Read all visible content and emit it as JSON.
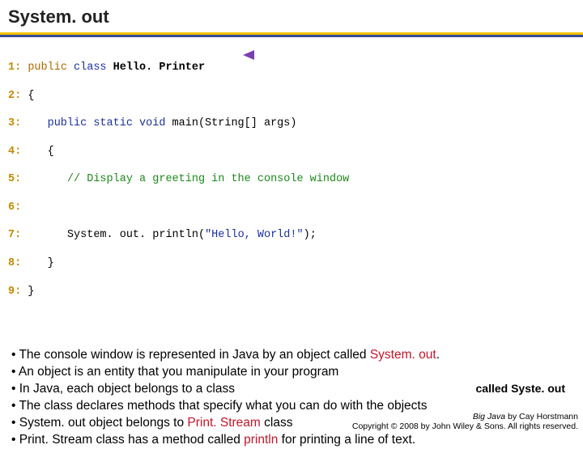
{
  "title": "System. out",
  "code": {
    "l1_ln": "1:",
    "l1_a": "public",
    "l1_b": " class ",
    "l1_c": "Hello. Printer",
    "l2_ln": "2:",
    "l2": " {",
    "l3_ln": "3:",
    "l3_a": "public static void",
    "l3_b": " main(String[] args)",
    "l4_ln": "4:",
    "l4": "    {",
    "l5_ln": "5:",
    "l5": "// Display a greeting in the console window",
    "l6_ln": "6:",
    "l7_ln": "7:",
    "l7_a": "System. out. println(",
    "l7_b": "\"Hello, World!\"",
    "l7_c": ");",
    "l8_ln": "8:",
    "l8": "    }",
    "l9_ln": "9:",
    "l9": " }"
  },
  "bullets": {
    "b1_a": "• The console window is represented in Java by an object called ",
    "b1_b": "System. out",
    "b1_c": ".",
    "b2": "• An object is an entity that you manipulate in your program",
    "b3": "• In Java, each object belongs to a class",
    "b4": "• The class declares methods that specify what you can do with the objects",
    "b5_a": "• System. out object belongs to ",
    "b5_b": "Print. Stream",
    "b5_c": " class",
    "b6_a": "• Print. Stream class has a method called ",
    "b6_b": "println",
    "b6_c": " for printing a line of text."
  },
  "subnote": "called Syste. out",
  "footer": {
    "line1_a": "Big Java",
    "line1_b": " by Cay Horstmann",
    "line2": "Copyright © 2008 by John Wiley & Sons. All rights reserved."
  },
  "colors": {
    "accent_red": "#c2152a",
    "rule_yellow": "#f2c200",
    "rule_blue": "#3b4a9a",
    "arrow_purple": "#7a3fb5"
  }
}
